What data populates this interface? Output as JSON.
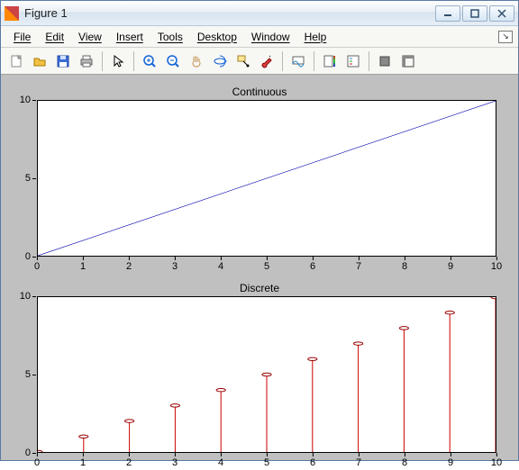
{
  "window": {
    "title": "Figure 1"
  },
  "menu": {
    "file": "File",
    "edit": "Edit",
    "view": "View",
    "insert": "Insert",
    "tools": "Tools",
    "desktop": "Desktop",
    "window": "Window",
    "help": "Help"
  },
  "toolbar_icons": {
    "new": "new-figure",
    "open": "open",
    "save": "save",
    "print": "print",
    "edit_plot": "pointer",
    "zoom_in": "zoom-in",
    "zoom_out": "zoom-out",
    "pan": "pan",
    "rotate": "rotate-3d",
    "data_cursor": "data-cursor",
    "brush": "brush",
    "link": "link-plots",
    "colorbar": "colorbar",
    "legend": "legend",
    "hide": "hide-tools",
    "show": "show-tools"
  },
  "chart_data": [
    {
      "type": "line",
      "title": "Continuous",
      "xlabel": "",
      "ylabel": "",
      "xlim": [
        0,
        10
      ],
      "ylim": [
        0,
        10
      ],
      "xticks": [
        0,
        1,
        2,
        3,
        4,
        5,
        6,
        7,
        8,
        9,
        10
      ],
      "yticks": [
        0,
        5,
        10
      ],
      "series": [
        {
          "name": "",
          "color": "#0000aa",
          "x": [
            0,
            10
          ],
          "y": [
            0,
            10
          ]
        }
      ]
    },
    {
      "type": "stem",
      "title": "Discrete",
      "xlabel": "",
      "ylabel": "",
      "xlim": [
        0,
        10
      ],
      "ylim": [
        0,
        10
      ],
      "xticks": [
        0,
        1,
        2,
        3,
        4,
        5,
        6,
        7,
        8,
        9,
        10
      ],
      "yticks": [
        0,
        5,
        10
      ],
      "series": [
        {
          "name": "",
          "color": "#cc0000",
          "x": [
            0,
            1,
            2,
            3,
            4,
            5,
            6,
            7,
            8,
            9,
            10
          ],
          "y": [
            0,
            1,
            2,
            3,
            4,
            5,
            6,
            7,
            8,
            9,
            10
          ]
        }
      ]
    }
  ]
}
